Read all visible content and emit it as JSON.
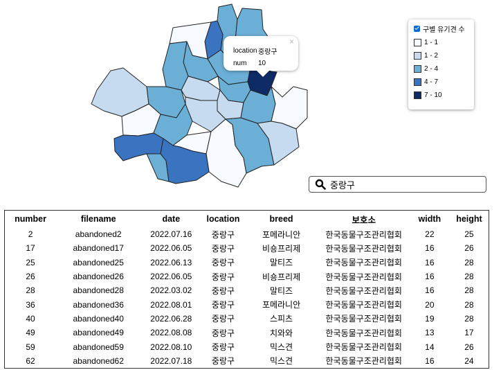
{
  "map": {
    "colors": {
      "c1": "#f7fbff",
      "c2": "#c6dbef",
      "c3": "#6baed6",
      "c4": "#3a73c0",
      "c5": "#0f2b66"
    },
    "popup": {
      "location_key": "location",
      "location_value": "중랑구",
      "num_key": "num",
      "num_value": "10",
      "close_glyph": "×"
    },
    "districts": [
      {
        "id": "dobong",
        "level": "c3"
      },
      {
        "id": "nowon",
        "level": "c3"
      },
      {
        "id": "gangbuk",
        "level": "c4"
      },
      {
        "id": "eunpyeong",
        "level": "c1"
      },
      {
        "id": "seongbuk",
        "level": "c3"
      },
      {
        "id": "jungnang",
        "level": "c5"
      },
      {
        "id": "jongno",
        "level": "c3"
      },
      {
        "id": "dongdaemun",
        "level": "c3"
      },
      {
        "id": "seodaemun",
        "level": "c3"
      },
      {
        "id": "gangseo",
        "level": "c2"
      },
      {
        "id": "mapo",
        "level": "c3"
      },
      {
        "id": "jung",
        "level": "c2"
      },
      {
        "id": "seongdong",
        "level": "c2"
      },
      {
        "id": "gwangjin",
        "level": "c3"
      },
      {
        "id": "gangdong",
        "level": "c1"
      },
      {
        "id": "yangcheon",
        "level": "c1"
      },
      {
        "id": "yeongdeungpo",
        "level": "c3"
      },
      {
        "id": "yongsan",
        "level": "c2"
      },
      {
        "id": "guro",
        "level": "c4"
      },
      {
        "id": "dongjak",
        "level": "c1"
      },
      {
        "id": "seocho",
        "level": "c1"
      },
      {
        "id": "gangnam",
        "level": "c3"
      },
      {
        "id": "songpa",
        "level": "c2"
      },
      {
        "id": "geumcheon",
        "level": "c3"
      },
      {
        "id": "gwanak",
        "level": "c4"
      }
    ]
  },
  "legend": {
    "title": "구별 유기견 수",
    "items": [
      {
        "label": "1 - 1",
        "color": "#f7fbff"
      },
      {
        "label": "1 - 2",
        "color": "#c6dbef"
      },
      {
        "label": "2 - 4",
        "color": "#6baed6"
      },
      {
        "label": "4 - 7",
        "color": "#3a73c0"
      },
      {
        "label": "7 - 10",
        "color": "#0f2b66"
      }
    ]
  },
  "search": {
    "value": "중랑구"
  },
  "table": {
    "headers": [
      "number",
      "filename",
      "date",
      "location",
      "breed",
      "보호소",
      "width",
      "height"
    ],
    "rows": [
      [
        "2",
        "abandoned2",
        "2022.07.16",
        "중랑구",
        "포메라니안",
        "한국동물구조관리협회",
        "22",
        "25"
      ],
      [
        "17",
        "abandoned17",
        "2022.06.05",
        "중랑구",
        "비숑프리제",
        "한국동물구조관리협회",
        "16",
        "26"
      ],
      [
        "25",
        "abandoned25",
        "2022.06.13",
        "중랑구",
        "말티즈",
        "한국동물구조관리협회",
        "16",
        "28"
      ],
      [
        "26",
        "abandoned26",
        "2022.06.05",
        "중랑구",
        "비숑프리제",
        "한국동물구조관리협회",
        "16",
        "28"
      ],
      [
        "28",
        "abandoned28",
        "2022.03.02",
        "중랑구",
        "말티즈",
        "한국동물구조관리협회",
        "16",
        "28"
      ],
      [
        "36",
        "abandoned36",
        "2022.08.01",
        "중랑구",
        "포메라니안",
        "한국동물구조관리협회",
        "20",
        "28"
      ],
      [
        "40",
        "abandoned40",
        "2022.06.28",
        "중랑구",
        "스피츠",
        "한국동물구조관리협회",
        "19",
        "28"
      ],
      [
        "49",
        "abandoned49",
        "2022.08.08",
        "중랑구",
        "치와와",
        "한국동물구조관리협회",
        "13",
        "17"
      ],
      [
        "59",
        "abandoned59",
        "2022.08.10",
        "중랑구",
        "믹스견",
        "한국동물구조관리협회",
        "14",
        "26"
      ],
      [
        "62",
        "abandoned62",
        "2022.07.18",
        "중랑구",
        "믹스견",
        "한국동물구조관리협회",
        "16",
        "24"
      ]
    ]
  }
}
